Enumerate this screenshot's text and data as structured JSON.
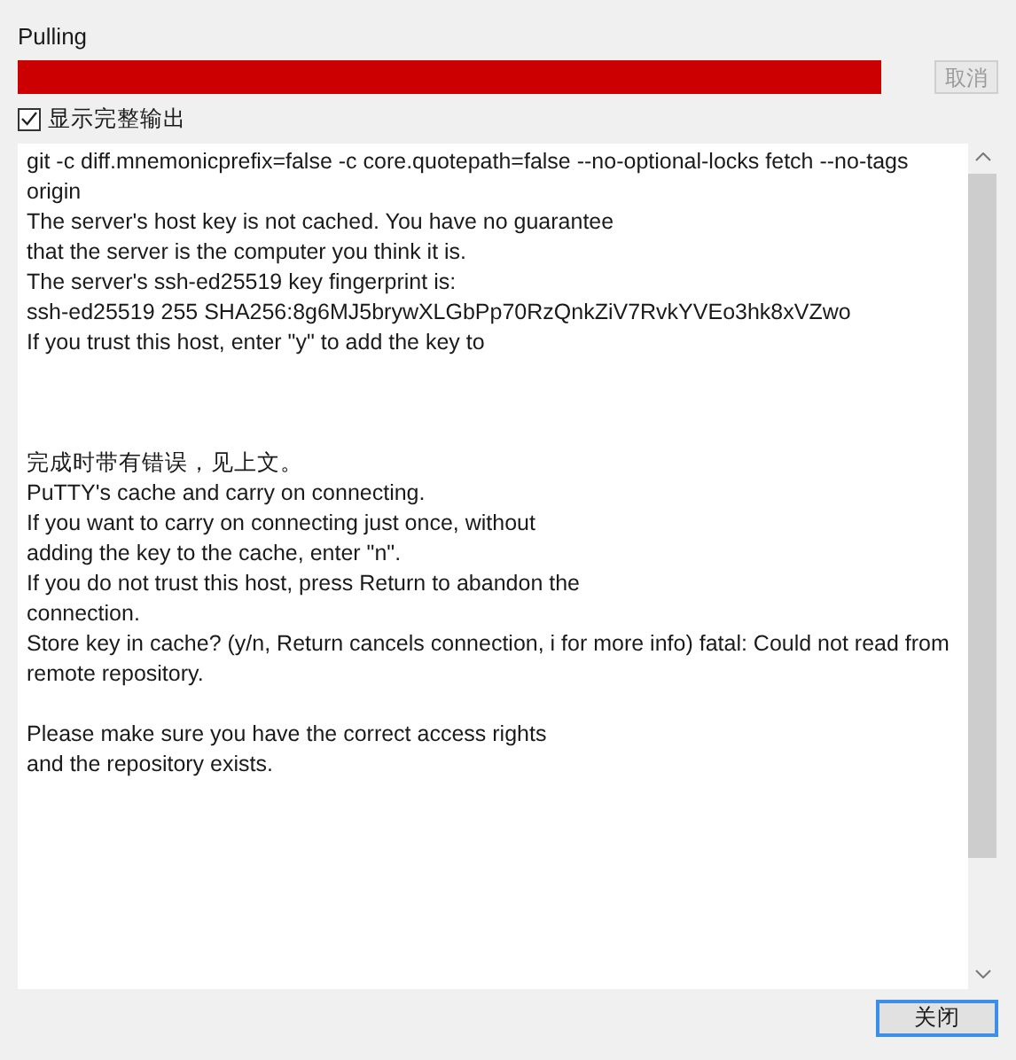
{
  "title": "Pulling",
  "progress": {
    "level": 1
  },
  "cancel_button": {
    "label": "取消",
    "disabled": true
  },
  "show_full_output": {
    "label": "显示完整输出",
    "checked": true
  },
  "output": "git -c diff.mnemonicprefix=false -c core.quotepath=false --no-optional-locks fetch --no-tags origin\nThe server's host key is not cached. You have no guarantee\nthat the server is the computer you think it is.\nThe server's ssh-ed25519 key fingerprint is:\nssh-ed25519 255 SHA256:8g6MJ5brywXLGbPp70RzQnkZiV7RvkYVEo3hk8xVZwo\nIf you trust this host, enter \"y\" to add the key to\n\n\n\n完成时带有错误，见上文。\nPuTTY's cache and carry on connecting.\nIf you want to carry on connecting just once, without\nadding the key to the cache, enter \"n\".\nIf you do not trust this host, press Return to abandon the\nconnection.\nStore key in cache? (y/n, Return cancels connection, i for more info) fatal: Could not read from remote repository.\n\nPlease make sure you have the correct access rights\nand the repository exists.",
  "close_button": {
    "label": "关闭"
  }
}
